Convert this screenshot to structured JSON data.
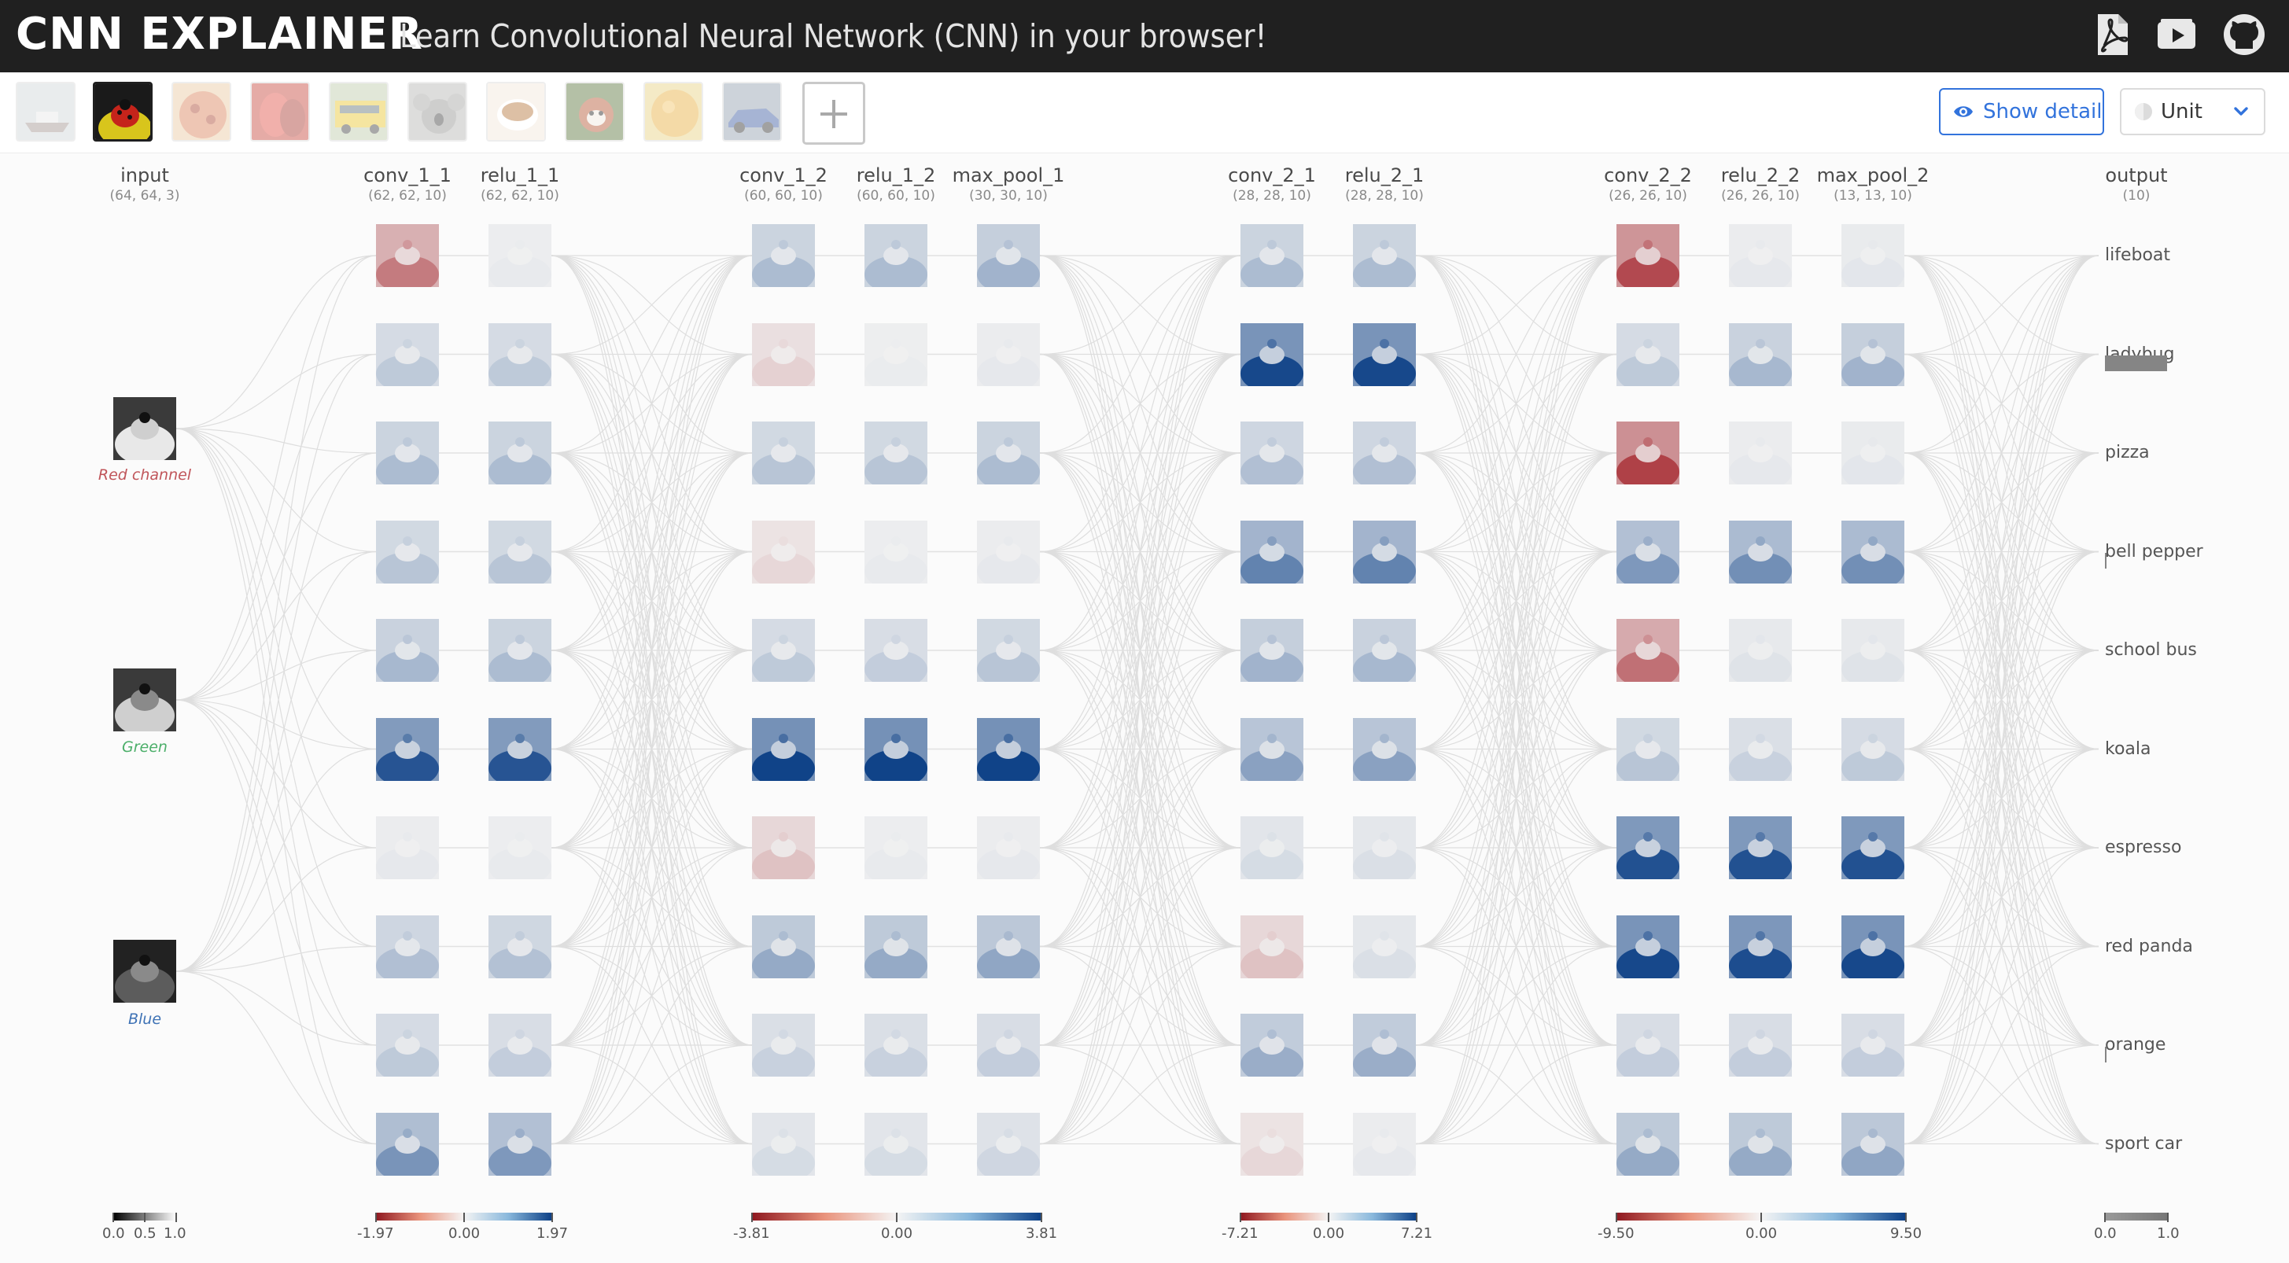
{
  "app": {
    "logo": "CNN EXPLAINER",
    "tagline": "Learn Convolutional Neural Network (CNN) in your browser!"
  },
  "header_icons": [
    "pdf-icon",
    "video-icon",
    "github-icon"
  ],
  "toolbar": {
    "thumbnails": [
      {
        "name": "lifeboat",
        "selected": false
      },
      {
        "name": "ladybug",
        "selected": true
      },
      {
        "name": "pizza",
        "selected": false
      },
      {
        "name": "bell pepper",
        "selected": false
      },
      {
        "name": "school bus",
        "selected": false
      },
      {
        "name": "koala",
        "selected": false
      },
      {
        "name": "espresso",
        "selected": false
      },
      {
        "name": "red panda",
        "selected": false
      },
      {
        "name": "orange",
        "selected": false
      },
      {
        "name": "sport car",
        "selected": false
      }
    ],
    "show_detail_label": "Show detail",
    "unit_selected": "Unit"
  },
  "colors": {
    "topbar": "#202020",
    "accent": "#3273dc",
    "positive": "#0b3f86",
    "negative": "#a01a22",
    "neutral": "#f1f1f1",
    "red_channel": "#c0555a",
    "green_channel": "#4caf6a",
    "blue_channel": "#3e72b5"
  },
  "input": {
    "name": "input",
    "dims": "(64, 64, 3)",
    "channels": [
      "Red channel",
      "Green",
      "Blue"
    ],
    "scale": {
      "min": "0.0",
      "mid": "0.5",
      "max": "1.0"
    }
  },
  "layers": [
    {
      "name": "conv_1_1",
      "dims": "(62, 62, 10)",
      "intensities": [
        -0.55,
        0.22,
        0.3,
        0.25,
        0.32,
        0.88,
        0.05,
        0.28,
        0.22,
        0.52
      ]
    },
    {
      "name": "relu_1_1",
      "dims": "(62, 62, 10)",
      "intensities": [
        0.04,
        0.22,
        0.3,
        0.25,
        0.3,
        0.88,
        0.04,
        0.27,
        0.2,
        0.5
      ]
    },
    {
      "name": "conv_1_2",
      "dims": "(60, 60, 10)",
      "intensities": [
        0.3,
        -0.15,
        0.25,
        -0.12,
        0.22,
        0.98,
        -0.22,
        0.4,
        0.18,
        0.12
      ]
    },
    {
      "name": "relu_1_2",
      "dims": "(60, 60, 10)",
      "intensities": [
        0.3,
        0.03,
        0.25,
        0.04,
        0.2,
        0.98,
        0.04,
        0.4,
        0.18,
        0.12
      ]
    },
    {
      "name": "max_pool_1",
      "dims": "(30, 30, 10)",
      "intensities": [
        0.35,
        0.05,
        0.3,
        0.05,
        0.25,
        0.98,
        0.05,
        0.42,
        0.2,
        0.15
      ]
    },
    {
      "name": "conv_2_1",
      "dims": "(28, 28, 10)",
      "intensities": [
        0.3,
        0.95,
        0.28,
        0.62,
        0.35,
        0.45,
        0.12,
        -0.22,
        0.38,
        -0.12
      ]
    },
    {
      "name": "relu_2_1",
      "dims": "(28, 28, 10)",
      "intensities": [
        0.3,
        0.95,
        0.28,
        0.62,
        0.32,
        0.45,
        0.1,
        0.1,
        0.38,
        0.05
      ]
    },
    {
      "name": "conv_2_2",
      "dims": "(26, 26, 10)",
      "intensities": [
        -0.78,
        0.22,
        -0.82,
        0.5,
        -0.6,
        0.25,
        0.9,
        0.95,
        0.2,
        0.4
      ]
    },
    {
      "name": "relu_2_2",
      "dims": "(26, 26, 10)",
      "intensities": [
        0.05,
        0.32,
        0.05,
        0.55,
        0.08,
        0.18,
        0.9,
        0.92,
        0.2,
        0.4
      ]
    },
    {
      "name": "max_pool_2",
      "dims": "(13, 13, 10)",
      "intensities": [
        0.06,
        0.35,
        0.06,
        0.55,
        0.08,
        0.22,
        0.9,
        0.95,
        0.2,
        0.42
      ]
    }
  ],
  "output": {
    "name": "output",
    "dims": "(10)",
    "classes": [
      "lifeboat",
      "ladybug",
      "pizza",
      "bell pepper",
      "school bus",
      "koala",
      "espresso",
      "red panda",
      "orange",
      "sport car"
    ],
    "probabilities": [
      0.0,
      0.99,
      0.0,
      0.01,
      0.0,
      0.0,
      0.0,
      0.0,
      0.01,
      0.0
    ],
    "scale": {
      "min": "0.0",
      "max": "1.0"
    }
  },
  "scales": [
    {
      "min": "-1.97",
      "mid": "0.00",
      "max": "1.97"
    },
    {
      "min": "-3.81",
      "mid": "0.00",
      "max": "3.81"
    },
    {
      "min": "-7.21",
      "mid": "0.00",
      "max": "7.21"
    },
    {
      "min": "-9.50",
      "mid": "0.00",
      "max": "9.50"
    }
  ]
}
